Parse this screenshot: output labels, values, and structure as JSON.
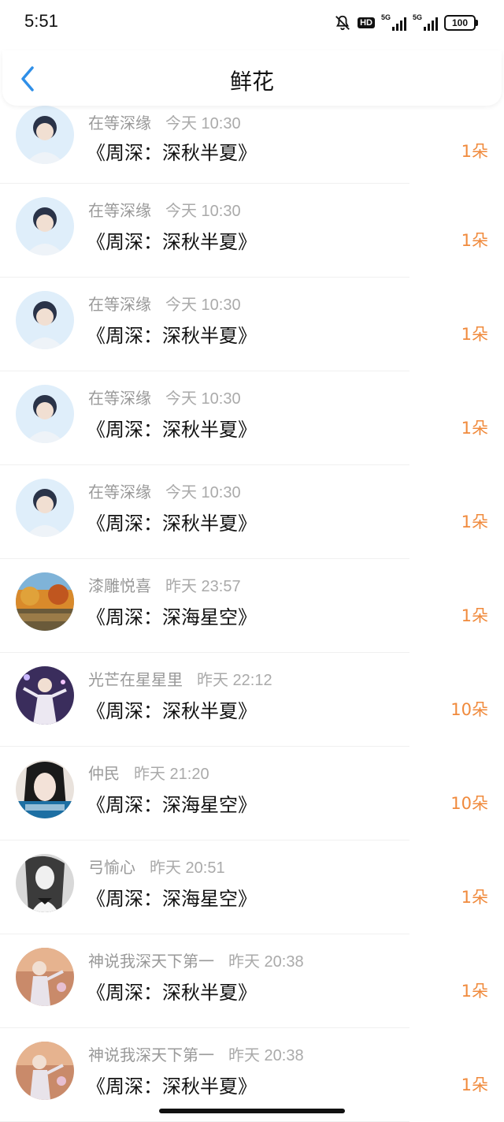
{
  "status_bar": {
    "time": "5:51",
    "hd": "HD",
    "net1": "5G",
    "net2": "5G",
    "battery": "100"
  },
  "header": {
    "back_icon": "chevron-left-icon",
    "title": "鲜花"
  },
  "colors": {
    "accent_blue": "#2f8fe8",
    "qty_orange": "#f08a3c",
    "meta_gray": "#999999"
  },
  "records": [
    {
      "name": "在等深缘",
      "time": "今天 10:30",
      "item": "《周深：深秋半夏》",
      "qty": "1朵"
    },
    {
      "name": "在等深缘",
      "time": "今天 10:30",
      "item": "《周深：深秋半夏》",
      "qty": "1朵"
    },
    {
      "name": "在等深缘",
      "time": "今天 10:30",
      "item": "《周深：深秋半夏》",
      "qty": "1朵"
    },
    {
      "name": "在等深缘",
      "time": "今天 10:30",
      "item": "《周深：深秋半夏》",
      "qty": "1朵"
    },
    {
      "name": "在等深缘",
      "time": "今天 10:30",
      "item": "《周深：深秋半夏》",
      "qty": "1朵"
    },
    {
      "name": "漆雕悦喜",
      "time": "昨天 23:57",
      "item": "《周深：深海星空》",
      "qty": "1朵"
    },
    {
      "name": "光芒在星星里",
      "time": "昨天 22:12",
      "item": "《周深：深秋半夏》",
      "qty": "10朵"
    },
    {
      "name": "仲民",
      "time": "昨天 21:20",
      "item": "《周深：深海星空》",
      "qty": "10朵"
    },
    {
      "name": "弓愉心",
      "time": "昨天 20:51",
      "item": "《周深：深海星空》",
      "qty": "1朵"
    },
    {
      "name": "神说我深天下第一",
      "time": "昨天 20:38",
      "item": "《周深：深秋半夏》",
      "qty": "1朵"
    },
    {
      "name": "神说我深天下第一",
      "time": "昨天 20:38",
      "item": "《周深：深秋半夏》",
      "qty": "1朵"
    }
  ]
}
